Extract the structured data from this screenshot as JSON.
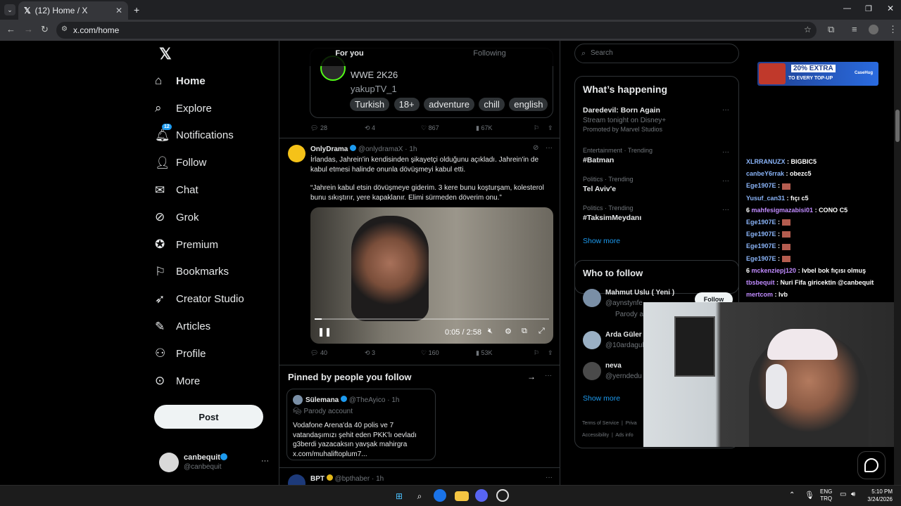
{
  "browser": {
    "tab_title": "(12) Home / X",
    "url": "x.com/home",
    "new_tab": "+",
    "close": "✕"
  },
  "nav": {
    "notification_count": "12",
    "items": [
      {
        "label": "Home",
        "icon": "home-icon"
      },
      {
        "label": "Explore",
        "icon": "search-icon"
      },
      {
        "label": "Notifications",
        "icon": "bell-icon"
      },
      {
        "label": "Follow",
        "icon": "person-add-icon"
      },
      {
        "label": "Chat",
        "icon": "mail-icon"
      },
      {
        "label": "Grok",
        "icon": "grok-icon"
      },
      {
        "label": "Premium",
        "icon": "verified-icon"
      },
      {
        "label": "Bookmarks",
        "icon": "bookmark-icon"
      },
      {
        "label": "Creator Studio",
        "icon": "rocket-icon"
      },
      {
        "label": "Articles",
        "icon": "article-icon"
      },
      {
        "label": "Profile",
        "icon": "person-icon"
      },
      {
        "label": "More",
        "icon": "more-circle-icon"
      }
    ],
    "post_label": "Post",
    "account_name": "canbequit",
    "account_handle": "@canbequit",
    "account_more": "···"
  },
  "feed": {
    "tabs": [
      "For you",
      "Following"
    ],
    "embed": {
      "game": "WWE 2K26",
      "streamer": "yakupTV_1",
      "tags": [
        "Turkish",
        "18+",
        "adventure",
        "chill",
        "english"
      ],
      "replies": "28",
      "reposts": "4",
      "likes": "867",
      "views": "67K"
    },
    "post1": {
      "name": "OnlyDrama",
      "handle": "@onlydramaX · 1h",
      "more": "···",
      "text1": "İrlandas, Jahrein'in kendisinden şikayetçi olduğunu açıkladı. Jahrein'in de kabul etmesi halinde onunla dövüşmeyi kabul etti.",
      "text2": "“Jahrein kabul etsin dövüşmeye giderim. 3 kere bunu koşturşam, kolesterol bunu sıkıştırır, yere kapaklanır. Elimi sürmeden döverim onu.”",
      "video_time": "0:05 / 2:58",
      "replies": "40",
      "reposts": "3",
      "likes": "160",
      "views": "53K"
    },
    "pinned": {
      "title": "Pinned by people you follow",
      "arrow": "→",
      "more": "···",
      "name": "Sülemana",
      "handle": "@TheAyico · 1h",
      "badge": "Parody account",
      "text": "Vodafone Arena'da 40 polis ve 7 vatandaşımızı şehit eden PKK'lı oevladı g3berdi yazacaksın yavşak mahirgra x.com/muhaliftoplum7..."
    },
    "post2": {
      "name": "BPT",
      "handle": "@bpthaber · 1h",
      "more": "···"
    }
  },
  "right": {
    "search_placeholder": "Search",
    "happening_title": "What’s happening",
    "trends": [
      {
        "title": "Daredevil: Born Again",
        "sub": "Stream tonight on Disney+",
        "promo": "Promoted by Marvel Studios"
      },
      {
        "meta": "Entertainment · Trending",
        "title": "#Batman"
      },
      {
        "meta": "Politics · Trending",
        "title": "Tel Aviv'e"
      },
      {
        "meta": "Politics · Trending",
        "title": "#TaksimMeydanı"
      }
    ],
    "trend_more": "···",
    "show_more": "Show more",
    "who_title": "Who to follow",
    "who": [
      {
        "name": "Mahmut Uslu ( Yeni )",
        "handle": "@aynstynfe",
        "badge": "Parody a"
      },
      {
        "name": "Arda Güler",
        "handle": "@10ardagul"
      },
      {
        "name": "neva",
        "handle": "@yerndedu"
      }
    ],
    "follow_label": "Follow",
    "who_more": "Show more",
    "footer1": "Terms of Service  |  Priva",
    "footer2": "Accessibility  |  Ads info"
  },
  "overlay": {
    "ad_text1": "20% EXTRA",
    "ad_text2": "TO EVERY TOP-UP",
    "ad_brand": "CaseHug",
    "chat": [
      {
        "user": "XLRRANUZX",
        "msg": "BIGBIC5",
        "cls": "n"
      },
      {
        "user": "canbeY6rrak",
        "msg": "obezc5",
        "cls": "n"
      },
      {
        "user": "Ege1907E",
        "msg": "",
        "cls": "n",
        "flag": true
      },
      {
        "user": "Yusuf_can31",
        "msg": "fıçı c5",
        "cls": "n"
      },
      {
        "user": "mahfesigmazabisi01",
        "msg": "CONO C5",
        "cls": "p"
      },
      {
        "user": "Ege1907E",
        "msg": "",
        "cls": "n",
        "flag": true
      },
      {
        "user": "Ege1907E",
        "msg": "",
        "cls": "n",
        "flag": true
      },
      {
        "user": "Ege1907E",
        "msg": "",
        "cls": "n",
        "flag": true
      },
      {
        "user": "Ege1907E",
        "msg": "",
        "cls": "n",
        "flag": true
      },
      {
        "user": "mckenziepj120",
        "msg": "Ivbel bok fıçısı olmuş",
        "cls": "p"
      },
      {
        "user": "tbsbequit",
        "msg": "Nuri Fifa giricektin @canbequit",
        "cls": "p"
      },
      {
        "user": "mertcom",
        "msg": "Ivb",
        "cls": "p"
      }
    ]
  },
  "taskbar": {
    "lang1": "ENG",
    "lang2": "TRQ",
    "time": "5:10 PM",
    "date": "3/24/2026"
  }
}
